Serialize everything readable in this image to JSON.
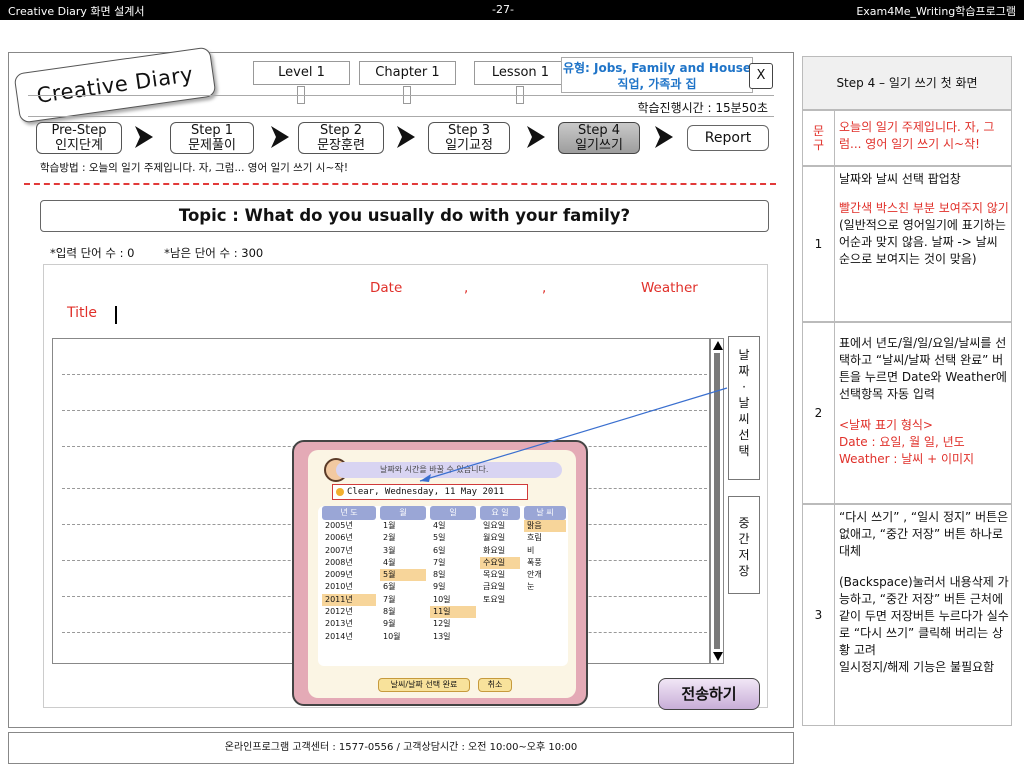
{
  "header": {
    "left": "Creative Diary 화면 설계서",
    "center": "-27-",
    "right": "Exam4Me_Writing학습프로그램"
  },
  "logo": "Creative Diary",
  "tabs": [
    "Level 1",
    "Chapter 1",
    "Lesson 1"
  ],
  "type_box": {
    "line1": "유형: Jobs, Family and House",
    "line2": "직업, 가족과 집"
  },
  "close_label": "X",
  "study_time": "학습진행시간 :  15분50초",
  "steps": [
    {
      "line1": "Pre-Step",
      "line2": "인지단계"
    },
    {
      "line1": "Step 1",
      "line2": "문제풀이"
    },
    {
      "line1": "Step 2",
      "line2": "문장훈련"
    },
    {
      "line1": "Step 3",
      "line2": "일기교정"
    },
    {
      "line1": "Step 4",
      "line2": "일기쓰기"
    }
  ],
  "report_label": "Report",
  "method": "학습방법 : 오늘의 일기 주제입니다.  자, 그럼... 영어 일기 쓰기 시~작!",
  "topic": "Topic :  What do you usually do with your family?",
  "counts": {
    "input": "*입력 단어 수 : 0",
    "remaining": "*남은 단어 수 : 300"
  },
  "editor": {
    "date_label": "Date",
    "comma1": ",",
    "comma2": ",",
    "weather_label": "Weather",
    "title_label": "Title"
  },
  "side_buttons": {
    "date_weather": "날\n짜\n·\n날\n씨\n선\n택",
    "temp_save": "중\n간\n저\n장"
  },
  "send_label": "전송하기",
  "popup": {
    "header": "날짜와 시간을 바꿀 수 있습니다.",
    "selected": "Clear, Wednesday, 11 May 2011",
    "columns": [
      {
        "head": "년 도",
        "items": [
          "2005년",
          "2006년",
          "2007년",
          "2008년",
          "2009년",
          "2010년",
          "2011년",
          "2012년",
          "2013년",
          "2014년"
        ],
        "selected_index": 6
      },
      {
        "head": "월",
        "items": [
          "1월",
          "2월",
          "3월",
          "4월",
          "5월",
          "6월",
          "7월",
          "8월",
          "9월",
          "10월"
        ],
        "selected_index": 4
      },
      {
        "head": "일",
        "items": [
          "4일",
          "5일",
          "6일",
          "7일",
          "8일",
          "9일",
          "10일",
          "11일",
          "12일",
          "13일"
        ],
        "selected_index": 7
      },
      {
        "head": "요 일",
        "items": [
          "일요일",
          "월요일",
          "화요일",
          "수요일",
          "목요일",
          "금요일",
          "토요일"
        ],
        "selected_index": 3
      },
      {
        "head": "날 씨",
        "items": [
          "맑음",
          "흐림",
          "비",
          "폭풍",
          "안개",
          "눈"
        ],
        "selected_index": 0
      }
    ],
    "confirm_label": "날씨/날짜 선택 완료",
    "cancel_label": "취소"
  },
  "footer": "온라인프로그램 고객센터 : 1577-0556    / 고객상담시간 : 오전 10:00~오후 10:00",
  "spec_table": {
    "header": "Step 4 – 일기 쓰기 첫 화면",
    "rows": [
      {
        "num": "문\n구",
        "text_red": "오늘의 일기 주제입니다.  자, 그럼... 영어 일기 쓰기 시~작!"
      },
      {
        "num": "1",
        "text": "날짜와 날씨 선택 팝업창",
        "text_red": "빨간색 박스친 부분 보여주지 않기",
        "text2": "(일반적으로 영어일기에 표기하는 어순과 맞지 않음. 날짜 -> 날씨 순으로 보여지는 것이 맞음)"
      },
      {
        "num": "2",
        "text": "표에서 년도/월/일/요일/날씨를 선택하고 “날씨/날짜 선택 완료” 버튼을 누르면 Date와 Weather에 선택항목 자동 입력",
        "text_red": "<날짜 표기 형식>\nDate : 요일, 월 일, 년도\nWeather :  날씨 + 이미지"
      },
      {
        "num": "3",
        "text": "“다시 쓰기” , “일시 정지” 버튼은 없애고, “중간 저장” 버튼 하나로 대체",
        "text2": "(Backspace)눌러서 내용삭제 가능하고, “중간 저장” 버튼 근처에 같이 두면 저장버튼 누르다가 실수로 “다시 쓰기” 클릭해 버리는 상황 고려\n일시정지/해제 기능은 불필요함"
      }
    ]
  },
  "colors": {
    "accent_red": "#e0302a",
    "type_blue": "#1f74c8",
    "popup_pink": "#e4aab6"
  }
}
